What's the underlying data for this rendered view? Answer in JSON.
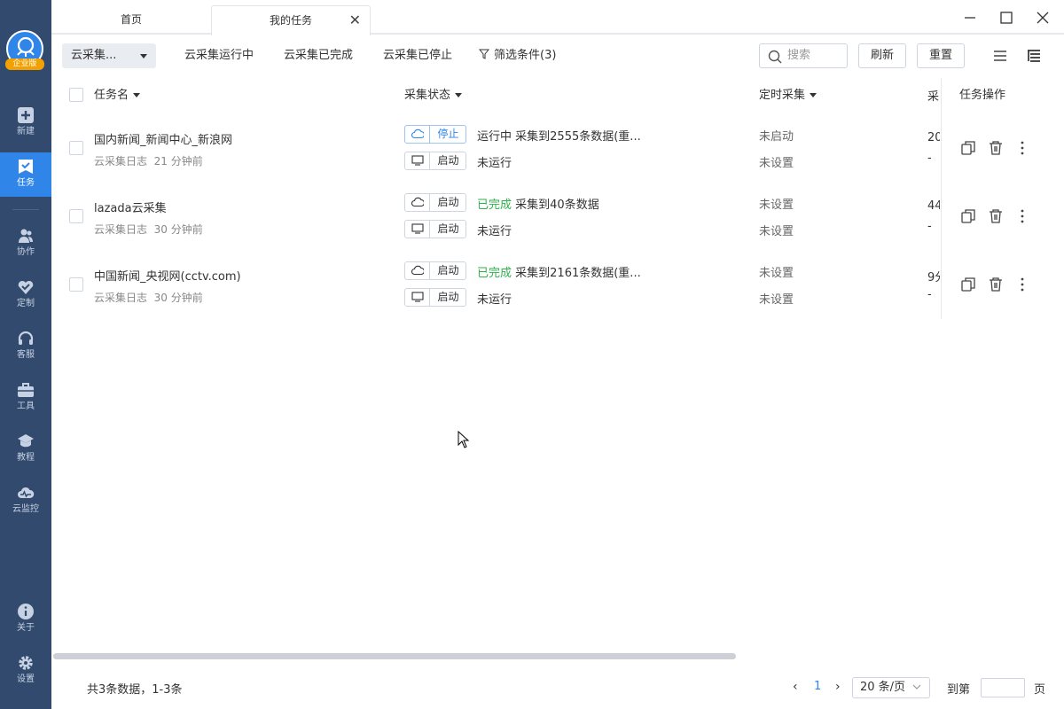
{
  "sidebar": {
    "logo_badge": "企业版",
    "items": [
      {
        "label": "新建",
        "icon": "plus-square-icon"
      },
      {
        "label": "任务",
        "icon": "task-icon",
        "active": true
      },
      {
        "label": "协作",
        "icon": "people-icon"
      },
      {
        "label": "定制",
        "icon": "heart-check-icon"
      },
      {
        "label": "客服",
        "icon": "headset-icon"
      },
      {
        "label": "工具",
        "icon": "toolbox-icon"
      },
      {
        "label": "教程",
        "icon": "graduation-cap-icon"
      },
      {
        "label": "云监控",
        "icon": "cloud-monitor-icon"
      },
      {
        "label": "关于",
        "icon": "info-icon"
      },
      {
        "label": "设置",
        "icon": "gear-icon"
      }
    ]
  },
  "tabs": {
    "home": "首页",
    "tasks": "我的任务",
    "close": "✕"
  },
  "toolbar": {
    "dropdown": "云采集...",
    "running": "云采集运行中",
    "completed": "云采集已完成",
    "stopped": "云采集已停止",
    "filter": "筛选条件(3)",
    "search_placeholder": "搜索",
    "refresh": "刷新",
    "reset": "重置"
  },
  "table": {
    "headers": {
      "name": "任务名",
      "status": "采集状态",
      "schedule": "定时采集",
      "clipped": "采",
      "ops": "任务操作"
    },
    "rows": [
      {
        "name": "国内新闻_新闻中心_新浪网",
        "log": "云采集日志",
        "time": "21 分钟前",
        "cloud_btn": "停止",
        "cloud_state": "运行中",
        "cloud_detail": "采集到2555条数据(重...",
        "local_btn": "启动",
        "local_state": "未运行",
        "sched1": "未启动",
        "sched2": "未设置",
        "clip1": "20",
        "clip2": "-"
      },
      {
        "name": "lazada云采集",
        "log": "云采集日志",
        "time": "30 分钟前",
        "cloud_btn": "启动",
        "cloud_state": "已完成",
        "cloud_detail": "采集到40条数据",
        "local_btn": "启动",
        "local_state": "未运行",
        "sched1": "未设置",
        "sched2": "未设置",
        "clip1": "44",
        "clip2": "-"
      },
      {
        "name": "中国新闻_央视网(cctv.com)",
        "log": "云采集日志",
        "time": "30 分钟前",
        "cloud_btn": "启动",
        "cloud_state": "已完成",
        "cloud_detail": "采集到2161条数据(重...",
        "local_btn": "启动",
        "local_state": "未运行",
        "sched1": "未设置",
        "sched2": "未设置",
        "clip1": "9分",
        "clip2": "-"
      }
    ]
  },
  "footer": {
    "total": "共3条数据，1-3条",
    "prev": "‹",
    "page": "1",
    "next": "›",
    "page_size": "20 条/页",
    "goto": "到第",
    "page_suffix": "页"
  }
}
